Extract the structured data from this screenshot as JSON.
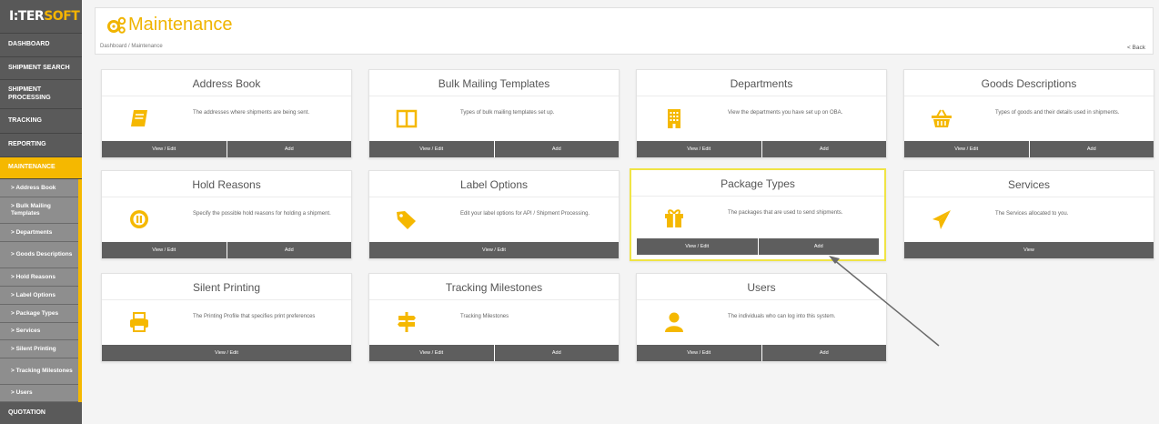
{
  "logo": {
    "part1": "I:TER",
    "part2": "SOFT"
  },
  "nav": {
    "dashboard": "DASHBOARD",
    "shipment_search": "SHIPMENT SEARCH",
    "shipment_processing": "SHIPMENT PROCESSING",
    "tracking": "TRACKING",
    "reporting": "REPORTING",
    "maintenance": "MAINTENANCE",
    "quotation": "QUOTATION"
  },
  "subnav": [
    "> Address Book",
    "> Bulk Mailing Templates",
    "> Departments",
    "> Goods Descriptions",
    "> Hold Reasons",
    "> Label Options",
    "> Package Types",
    "> Services",
    "> Silent Printing",
    "> Tracking Milestones",
    "> Users"
  ],
  "header": {
    "title": "Maintenance",
    "breadcrumb": "Dashboard / Maintenance",
    "back": "< Back"
  },
  "accent": "#f5b800",
  "cards": [
    {
      "title": "Address Book",
      "icon": "book-icon",
      "desc": "The addresses where shipments are being sent.",
      "buttons": [
        "View / Edit",
        "Add"
      ]
    },
    {
      "title": "Bulk Mailing Templates",
      "icon": "columns-icon",
      "desc": "Types of bulk mailing templates set up.",
      "buttons": [
        "View / Edit",
        "Add"
      ]
    },
    {
      "title": "Departments",
      "icon": "building-icon",
      "desc": "View the departments you have set up on OBA.",
      "buttons": [
        "View / Edit",
        "Add"
      ]
    },
    {
      "title": "Goods Descriptions",
      "icon": "basket-icon",
      "desc": "Types of goods and their details used in shipments.",
      "buttons": [
        "View / Edit",
        "Add"
      ]
    },
    {
      "title": "Hold Reasons",
      "icon": "pause-icon",
      "desc": "Specify the possible hold reasons for holding a shipment.",
      "buttons": [
        "View / Edit",
        "Add"
      ]
    },
    {
      "title": "Label Options",
      "icon": "tags-icon",
      "desc": "Edit your label options for API / Shipment Processing.",
      "buttons": [
        "View / Edit"
      ]
    },
    {
      "title": "Package Types",
      "icon": "gift-icon",
      "desc": "The packages that are used to send shipments.",
      "buttons": [
        "View / Edit",
        "Add"
      ]
    },
    {
      "title": "Services",
      "icon": "paper-plane-icon",
      "desc": "The Services allocated to you.",
      "buttons": [
        "View"
      ]
    },
    {
      "title": "Silent Printing",
      "icon": "printer-icon",
      "desc": "The Printing Profile that specifies print preferences",
      "buttons": [
        "View / Edit"
      ]
    },
    {
      "title": "Tracking Milestones",
      "icon": "signpost-icon",
      "desc": "Tracking Milestones",
      "buttons": [
        "View / Edit",
        "Add"
      ]
    },
    {
      "title": "Users",
      "icon": "user-icon",
      "desc": "The individuals who can log into this system.",
      "buttons": [
        "View / Edit",
        "Add"
      ]
    }
  ]
}
